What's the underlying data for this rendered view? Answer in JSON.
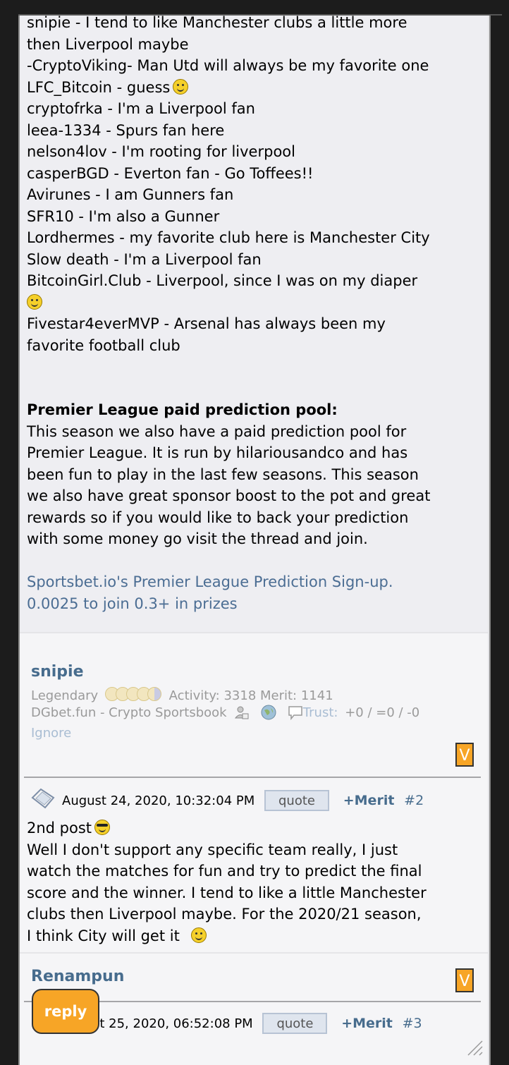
{
  "post1": {
    "lines": [
      "snipie - I tend to like Manchester clubs a little more",
      "then Liverpool maybe",
      "-CryptoViking- Man Utd will always be my favorite one",
      "LFC_Bitcoin - guess",
      "cryptofrka - I'm a Liverpool fan",
      "leea-1334 - Spurs fan here",
      "nelson4lov - I'm rooting for liverpool",
      "casperBGD - Everton fan - Go Toffees!!",
      "Avirunes - I am Gunners fan",
      "SFR10 - I'm also a Gunner",
      "Lordhermes - my favorite club here is Manchester City",
      "Slow death - I'm a Liverpool fan",
      "BitcoinGirl.Club - Liverpool, since I was on my diaper",
      "Fivestar4everMVP - Arsenal has always been my",
      "favorite football club"
    ],
    "pool_heading": "Premier League paid prediction pool:",
    "pool_text": [
      "This season we also have a paid prediction pool for",
      "Premier League. It is run by hilariousandco and has",
      "been fun to play in the last few seasons. This season",
      "we also have great sponsor boost to the pot and great",
      "rewards so if you would like to back your prediction",
      "with some money go visit the thread and join."
    ],
    "link_line1": "Sportsbet.io's Premier League Prediction Sign-up.",
    "link_line2": "0.0025 to join 0.3+ in prizes"
  },
  "post2": {
    "username": "snipie",
    "rank": "Legendary",
    "activity": "Activity: 3318 Merit: 1141",
    "signature": "DGbet.fun - Crypto Sportsbook",
    "trust_label": "Trust:",
    "trust_value": "+0 / =0 / -0",
    "ignore": "Ignore",
    "v_label": "V",
    "date": "August 24, 2020, 10:32:04 PM",
    "quote_label": "quote",
    "merit_label": "+Merit",
    "post_number": "#2",
    "body": [
      "2nd post",
      "Well I don't support any specific team really, I just",
      "watch the matches for fun and try to predict the final",
      "score and the winner. I tend to like a little Manchester",
      "clubs then Liverpool maybe. For the 2020/21 season,",
      "I think City will get it"
    ]
  },
  "post3": {
    "username": "Renampun",
    "v_label": "V",
    "date_partial": "st 25, 2020, 06:52:08 PM",
    "quote_label": "quote",
    "merit_label": "+Merit",
    "post_number": "#3"
  },
  "reply_label": "reply"
}
